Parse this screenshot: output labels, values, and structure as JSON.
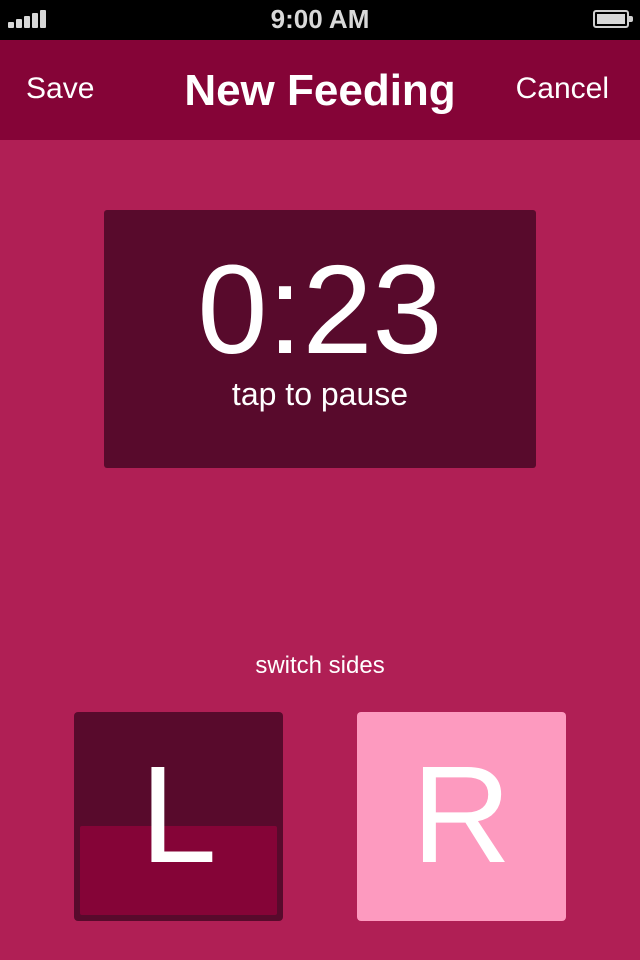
{
  "status_bar": {
    "time": "9:00 AM",
    "signal_icon": "signal-bars-icon",
    "battery_icon": "battery-icon"
  },
  "nav": {
    "save_label": "Save",
    "title": "New Feeding",
    "cancel_label": "Cancel"
  },
  "timer": {
    "value": "0:23",
    "hint": "tap to pause"
  },
  "sides": {
    "label": "switch sides",
    "left_label": "L",
    "right_label": "R",
    "left_progress": 0.45
  },
  "colors": {
    "background": "#b01f55",
    "nav_bar": "#850437",
    "timer_card": "#580a2c",
    "left_button": "#580a2c",
    "left_fill": "#850437",
    "right_button": "#fd9abf",
    "status_bar": "#000000",
    "text": "#ffffff"
  }
}
